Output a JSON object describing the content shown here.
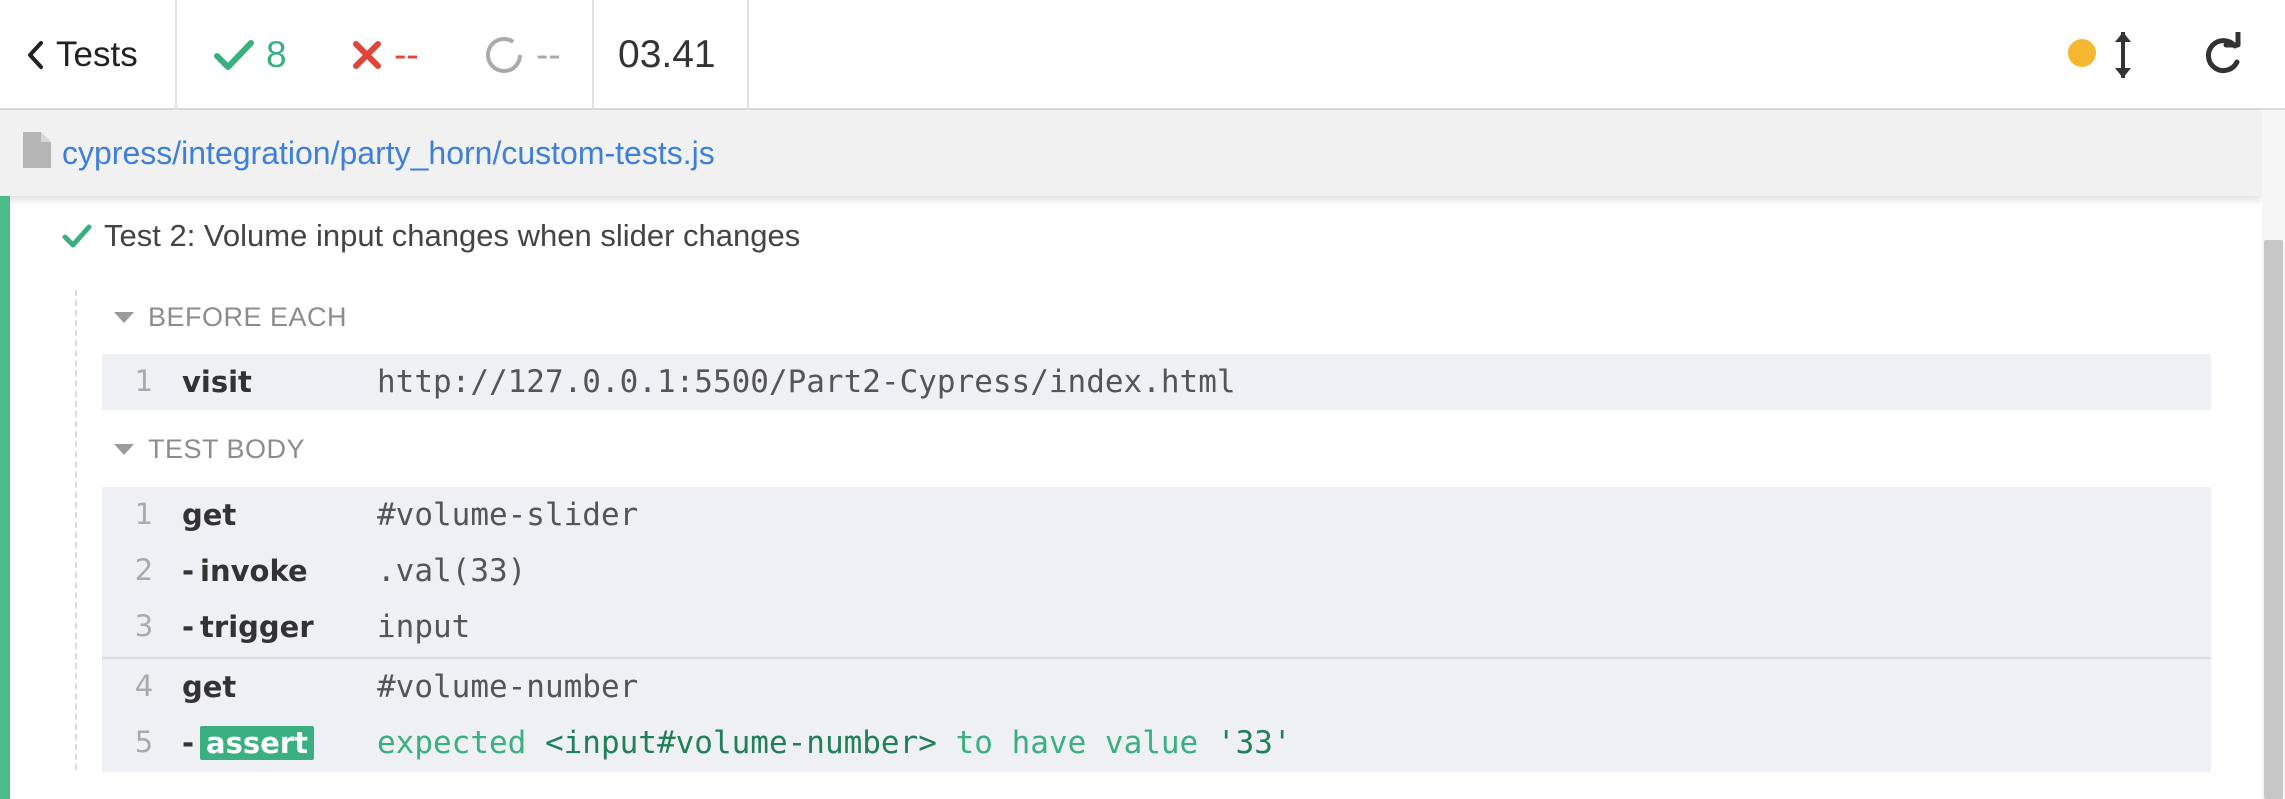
{
  "header": {
    "back_label": "Tests",
    "passed": "8",
    "failed": "--",
    "pending": "--",
    "duration": "03.41",
    "indicator_color": "#f3b731"
  },
  "file": {
    "path": "cypress/integration/party_horn/custom-tests.js"
  },
  "test": {
    "title": "Test 2: Volume input changes when slider changes",
    "status": "passed"
  },
  "before_each": {
    "heading": "BEFORE EACH",
    "commands": [
      {
        "num": "1",
        "name": "visit",
        "message": "http://127.0.0.1:5500/Part2-Cypress/index.html"
      }
    ]
  },
  "test_body": {
    "heading": "TEST BODY",
    "commands": [
      {
        "num": "1",
        "name": "get",
        "message": "#volume-slider"
      },
      {
        "num": "2",
        "name": "invoke",
        "message": ".val(33)"
      },
      {
        "num": "3",
        "name": "trigger",
        "message": "input"
      },
      {
        "num": "4",
        "name": "get",
        "message": "#volume-number"
      },
      {
        "num": "5",
        "name": "assert",
        "msg_parts": [
          "expected",
          "<input#volume-number>",
          "to have value",
          "'33'"
        ]
      }
    ]
  },
  "colors": {
    "pass": "#3aaf7f",
    "fail": "#e0453a",
    "link": "#3d7fd9",
    "rail": "#4cbb8a"
  }
}
